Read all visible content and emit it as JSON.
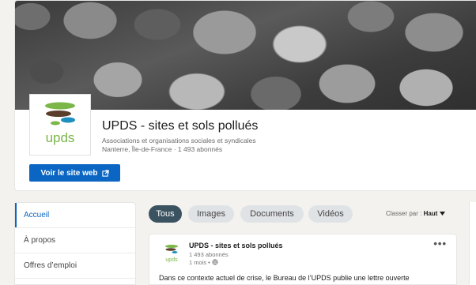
{
  "company": {
    "name": "UPDS - sites et sols pollués",
    "industry": "Associations et organisations sociales et syndicales",
    "location_followers": "Nanterre, Île-de-France · 1 493 abonnés",
    "logo_text": "upds"
  },
  "header": {
    "website_button": "Voir le site web"
  },
  "nav": {
    "items": [
      {
        "label": "Accueil"
      },
      {
        "label": "À propos"
      },
      {
        "label": "Offres d’emploi"
      }
    ]
  },
  "filters": {
    "pills": [
      {
        "label": "Tous"
      },
      {
        "label": "Images"
      },
      {
        "label": "Documents"
      },
      {
        "label": "Vidéos"
      }
    ],
    "sort_label": "Classer par :",
    "sort_value": "Haut"
  },
  "post": {
    "author": "UPDS - sites et sols pollués",
    "followers": "1 493 abonnés",
    "time": "1 mois •",
    "more": "•••",
    "logo_text": "upds",
    "text": "Dans ce contexte actuel de crise, le Bureau de l’UPDS publie une lettre ouverte"
  },
  "colors": {
    "accent": "#0a66c2",
    "pill_active": "#3b5361",
    "logo_green": "#7ab648",
    "logo_blue": "#1c8fbf",
    "logo_brown": "#5a3e2b"
  }
}
